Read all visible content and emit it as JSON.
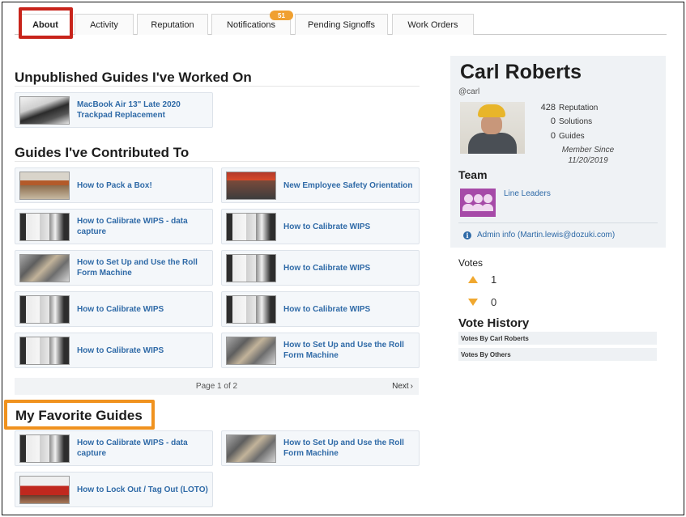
{
  "tabs": [
    {
      "label": "About"
    },
    {
      "label": "Activity"
    },
    {
      "label": "Reputation"
    },
    {
      "label": "Notifications",
      "badge": "51"
    },
    {
      "label": "Pending Signoffs"
    },
    {
      "label": "Work Orders"
    }
  ],
  "unpublished": {
    "title": "Unpublished Guides I've Worked On",
    "guides": [
      {
        "title": "MacBook Air 13\" Late 2020 Trackpad Replacement",
        "thumb": "laptop-photo"
      }
    ]
  },
  "contributed": {
    "title": "Guides I've Contributed To",
    "guides": [
      {
        "title": "How to Pack a Box!",
        "thumb": "box-photo"
      },
      {
        "title": "New Employee Safety Orientation",
        "thumb": "safety-photo"
      },
      {
        "title": "How to Calibrate WIPS - data capture",
        "thumb": "wips-photo"
      },
      {
        "title": "How to Calibrate WIPS",
        "thumb": "wips-photo"
      },
      {
        "title": "How to Set Up and Use the Roll Form Machine",
        "thumb": "roll-form-photo"
      },
      {
        "title": "How to Calibrate WIPS",
        "thumb": "wips-photo"
      },
      {
        "title": "How to Calibrate WIPS",
        "thumb": "wips-photo"
      },
      {
        "title": "How to Calibrate WIPS",
        "thumb": "wips-photo"
      },
      {
        "title": "How to Calibrate WIPS",
        "thumb": "wips-photo"
      },
      {
        "title": "How to Set Up and Use the Roll Form Machine",
        "thumb": "roll-form-photo"
      }
    ],
    "pagination": {
      "label": "Page 1 of 2",
      "next": "Next"
    }
  },
  "favorites": {
    "title": "My Favorite Guides",
    "guides": [
      {
        "title": "How to Calibrate WIPS - data capture",
        "thumb": "wips-photo"
      },
      {
        "title": "How to Set Up and Use the Roll Form Machine",
        "thumb": "roll-form-photo"
      },
      {
        "title": "How to Lock Out / Tag Out (LOTO)",
        "thumb": "loto-photo"
      }
    ]
  },
  "profile": {
    "name": "Carl Roberts",
    "handle": "@carl",
    "stats": [
      {
        "value": "428",
        "label": "Reputation"
      },
      {
        "value": "0",
        "label": "Solutions"
      },
      {
        "value": "0",
        "label": "Guides"
      }
    ],
    "member_since_label": "Member Since",
    "member_since_date": "11/20/2019",
    "team_title": "Team",
    "team_name": "Line Leaders",
    "admin_info": "Admin info (Martin.lewis@dozuki.com)"
  },
  "votes": {
    "title": "Votes",
    "up": "1",
    "down": "0",
    "history_title": "Vote History",
    "history": [
      "Votes By Carl Roberts",
      "Votes By Others"
    ]
  },
  "colors": {
    "link": "#2f6aa7",
    "tab_highlight": "#c8241b",
    "favorites_highlight": "#f0921e",
    "badge": "#f0a030",
    "vote_arrow": "#f0a830"
  }
}
